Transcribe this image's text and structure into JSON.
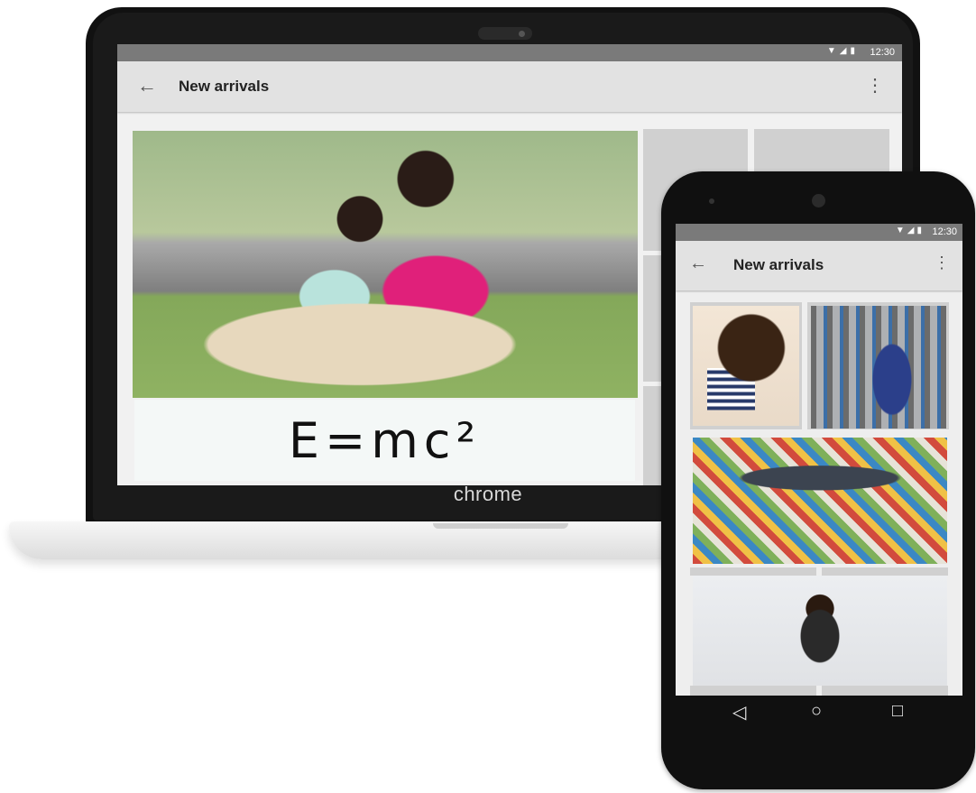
{
  "laptop": {
    "brand": "chrome",
    "status_bar": {
      "time": "12:30",
      "icons": "▼◢▮"
    },
    "app_bar": {
      "back_icon": "←",
      "title": "New arrivals",
      "menu_icon": "⋮"
    },
    "gallery": {
      "images": [
        "Two girls reading a book on library floor",
        "E = mc² rocket drawing"
      ],
      "emc_text": "E=mc²"
    }
  },
  "phone": {
    "status_bar": {
      "time": "12:30",
      "icons": "▼◢▮"
    },
    "app_bar": {
      "back_icon": "←",
      "title": "New arrivals",
      "menu_icon": "⋮"
    },
    "nav": {
      "back": "◁",
      "home": "○",
      "recents": "□"
    }
  }
}
